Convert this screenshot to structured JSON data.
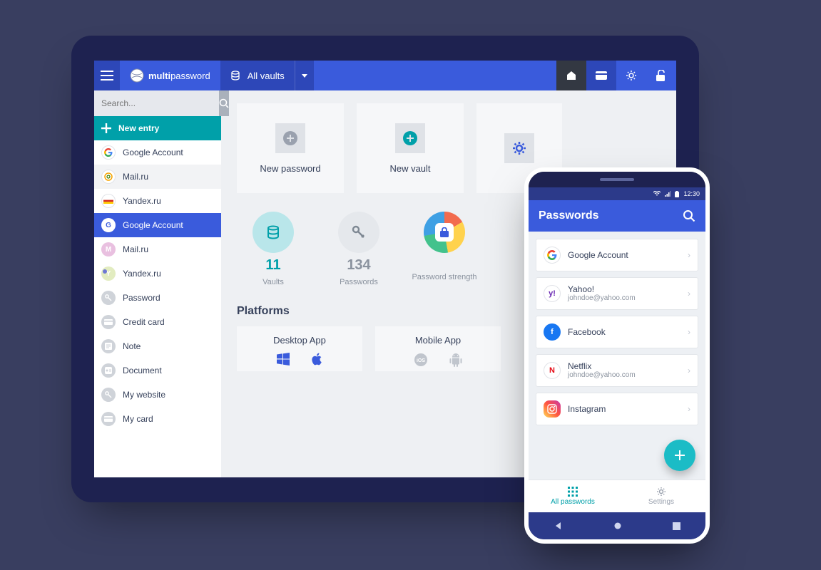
{
  "tablet": {
    "brand_prefix": "multi",
    "brand_suffix": "password",
    "vault_label": "All vaults",
    "search_placeholder": "Search...",
    "new_entry": "New entry",
    "sidebar": [
      {
        "label": "Google Account"
      },
      {
        "label": "Mail.ru"
      },
      {
        "label": "Yandex.ru"
      },
      {
        "label": "Google Account"
      },
      {
        "label": "Mail.ru"
      },
      {
        "label": "Yandex.ru"
      },
      {
        "label": "Password"
      },
      {
        "label": "Credit card"
      },
      {
        "label": "Note"
      },
      {
        "label": "Document"
      },
      {
        "label": "My website"
      },
      {
        "label": "My card"
      }
    ],
    "cards": {
      "new_password": "New password",
      "new_vault": "New vault"
    },
    "stats": {
      "vaults_count": "11",
      "vaults_label": "Vaults",
      "passwords_count": "134",
      "passwords_label": "Passwords",
      "strength_label": "Password strength"
    },
    "platforms": {
      "heading": "Platforms",
      "desktop": "Desktop App",
      "mobile": "Mobile App"
    }
  },
  "phone": {
    "time": "12:30",
    "title": "Passwords",
    "rows": [
      {
        "title": "Google Account",
        "sub": ""
      },
      {
        "title": "Yahoo!",
        "sub": "johndoe@yahoo.com"
      },
      {
        "title": "Facebook",
        "sub": ""
      },
      {
        "title": "Netflix",
        "sub": "johndoe@yahoo.com"
      },
      {
        "title": "Instagram",
        "sub": ""
      }
    ],
    "nav": {
      "all": "All passwords",
      "settings": "Settings"
    }
  }
}
